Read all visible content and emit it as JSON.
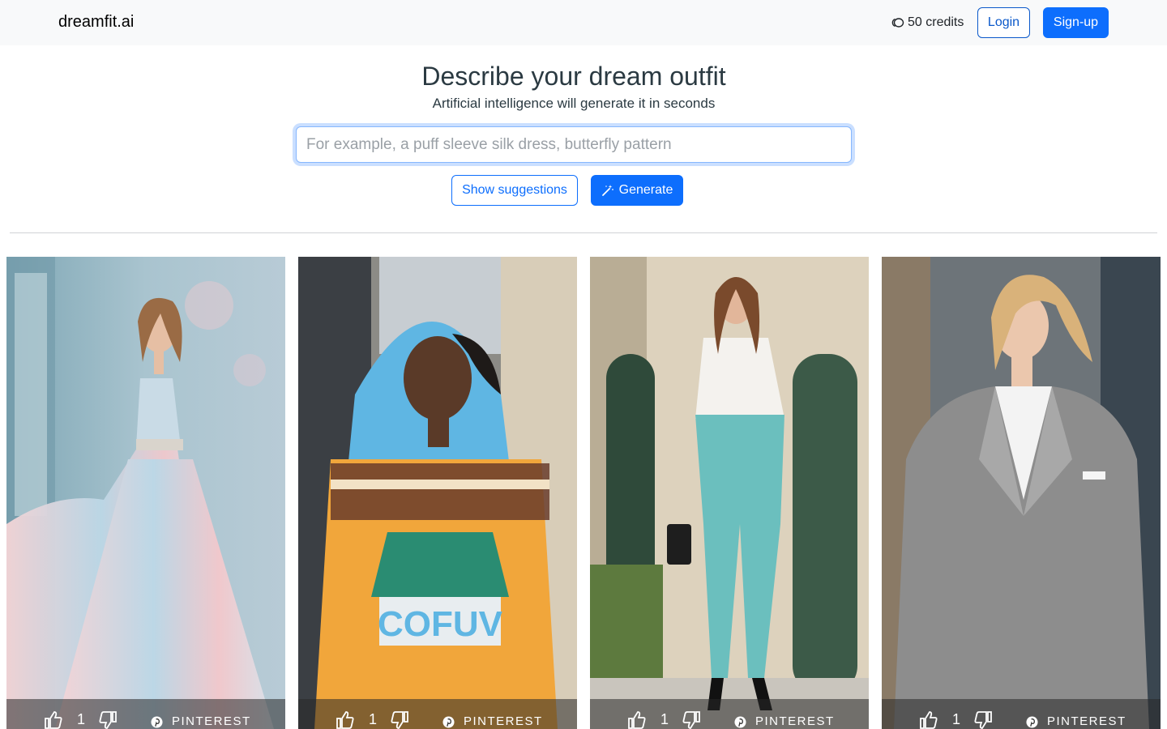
{
  "navbar": {
    "brand": "dreamfit.ai",
    "credits": "50 credits",
    "login_label": "Login",
    "signup_label": "Sign-up"
  },
  "hero": {
    "title": "Describe your dream outfit",
    "subtitle": "Artificial intelligence will generate it in seconds",
    "input_placeholder": "For example, a puff sleeve silk dress, butterfly pattern",
    "input_value": "",
    "suggest_label": "Show suggestions",
    "generate_label": "Generate"
  },
  "gallery": [
    {
      "likes": "1",
      "share_label": "PINTEREST"
    },
    {
      "likes": "1",
      "share_label": "PINTEREST"
    },
    {
      "likes": "1",
      "share_label": "PINTEREST"
    },
    {
      "likes": "1",
      "share_label": "PINTEREST"
    }
  ],
  "colors": {
    "primary": "#0d6efd",
    "navbar_bg": "#f8f9fa",
    "overlay": "#282828"
  }
}
